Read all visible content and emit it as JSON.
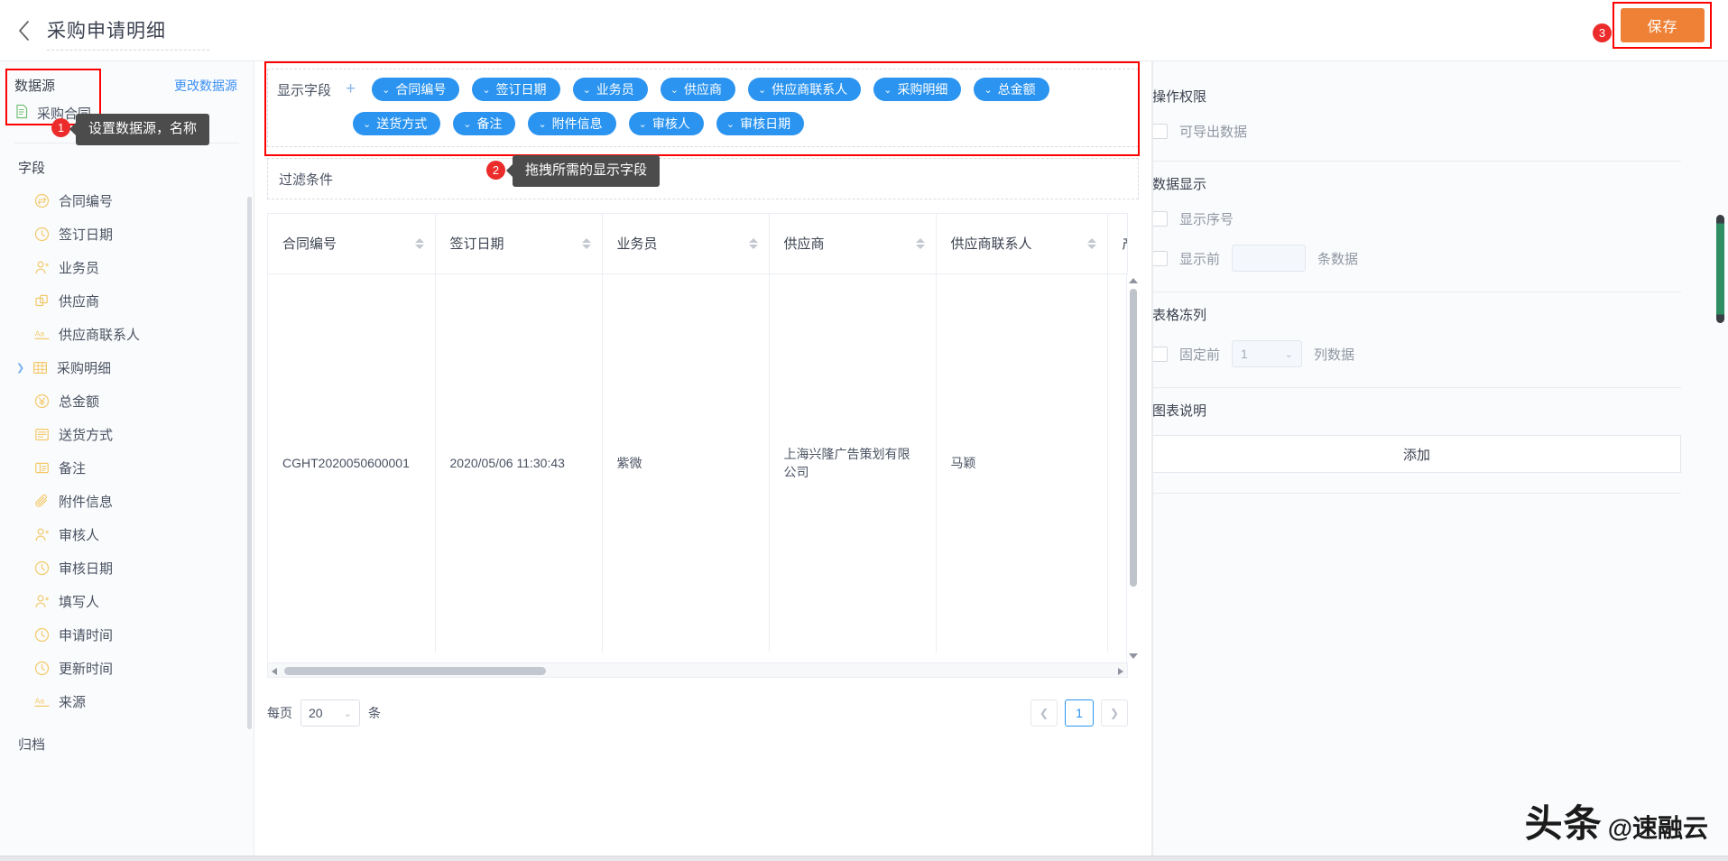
{
  "header": {
    "back_icon": "chevron-left-icon",
    "title": "采购申请明细",
    "save_label": "保存",
    "badge_3": "3"
  },
  "sidebar": {
    "datasource_title": "数据源",
    "change_datasource_link": "更改数据源",
    "datasource_name": "采购合同",
    "datasource_icon": "document-icon",
    "badge_1": "1",
    "tooltip_1": "设置数据源，名称",
    "fields_title": "字段",
    "fields": [
      {
        "label": "合同编号",
        "icon": "sequence-icon",
        "expandable": false
      },
      {
        "label": "签订日期",
        "icon": "clock-icon",
        "expandable": false
      },
      {
        "label": "业务员",
        "icon": "person-icon",
        "expandable": false
      },
      {
        "label": "供应商",
        "icon": "copy-icon",
        "expandable": false
      },
      {
        "label": "供应商联系人",
        "icon": "text-aa-icon",
        "expandable": false
      },
      {
        "label": "采购明细",
        "icon": "table-icon",
        "expandable": true
      },
      {
        "label": "总金额",
        "icon": "currency-yuan-icon",
        "expandable": false
      },
      {
        "label": "送货方式",
        "icon": "list-icon",
        "expandable": false
      },
      {
        "label": "备注",
        "icon": "note-icon",
        "expandable": false
      },
      {
        "label": "附件信息",
        "icon": "paperclip-icon",
        "expandable": false
      },
      {
        "label": "审核人",
        "icon": "person-icon",
        "expandable": false
      },
      {
        "label": "审核日期",
        "icon": "clock-icon",
        "expandable": false
      },
      {
        "label": "填写人",
        "icon": "person-icon",
        "expandable": false
      },
      {
        "label": "申请时间",
        "icon": "clock-icon",
        "expandable": false
      },
      {
        "label": "更新时间",
        "icon": "clock-icon",
        "expandable": false
      },
      {
        "label": "来源",
        "icon": "text-aa-icon",
        "expandable": false
      }
    ],
    "archived_label": "归档"
  },
  "canvas": {
    "display_fields_label": "显示字段",
    "add_icon": "plus-icon",
    "chips_row1": [
      "合同编号",
      "签订日期",
      "业务员",
      "供应商",
      "供应商联系人",
      "采购明细",
      "总金额"
    ],
    "chips_row2": [
      "送货方式",
      "备注",
      "附件信息",
      "审核人",
      "审核日期"
    ],
    "filter_label": "过滤条件",
    "badge_2": "2",
    "tooltip_2": "拖拽所需的显示字段",
    "table": {
      "columns": [
        "合同编号",
        "签订日期",
        "业务员",
        "供应商",
        "供应商联系人",
        "产"
      ],
      "rows": [
        [
          "CGHT2020050600001",
          "2020/05/06 11:30:43",
          "紫微",
          "上海兴隆广告策划有限公司",
          "马颖",
          ""
        ]
      ]
    },
    "pagination": {
      "per_page_label": "每页",
      "per_page_value": "20",
      "unit_label": "条",
      "prev_icon": "chevron-left-icon",
      "next_icon": "chevron-right-icon",
      "current_page": "1"
    }
  },
  "right_panel": {
    "sections": [
      {
        "title": "操作权限",
        "rows": [
          {
            "type": "checkbox",
            "label": "可导出数据"
          }
        ]
      },
      {
        "title": "数据显示",
        "rows": [
          {
            "type": "checkbox",
            "label": "显示序号"
          },
          {
            "type": "checkbox-input",
            "label": "显示前",
            "value": "",
            "suffix": "条数据"
          }
        ]
      },
      {
        "title": "表格冻列",
        "rows": [
          {
            "type": "checkbox-select",
            "label": "固定前",
            "value": "1",
            "suffix": "列数据"
          }
        ]
      },
      {
        "title": "图表说明",
        "rows": [
          {
            "type": "button",
            "label": "添加"
          }
        ]
      }
    ]
  },
  "watermark": {
    "main": "头条",
    "at": "@速融云"
  },
  "colors": {
    "accent_blue": "#2b94f0",
    "save_orange": "#ee8136",
    "highlight_red": "#ff0000",
    "field_icon_yellow": "#f3c96b",
    "tooltip_bg": "#4c4c4c"
  }
}
